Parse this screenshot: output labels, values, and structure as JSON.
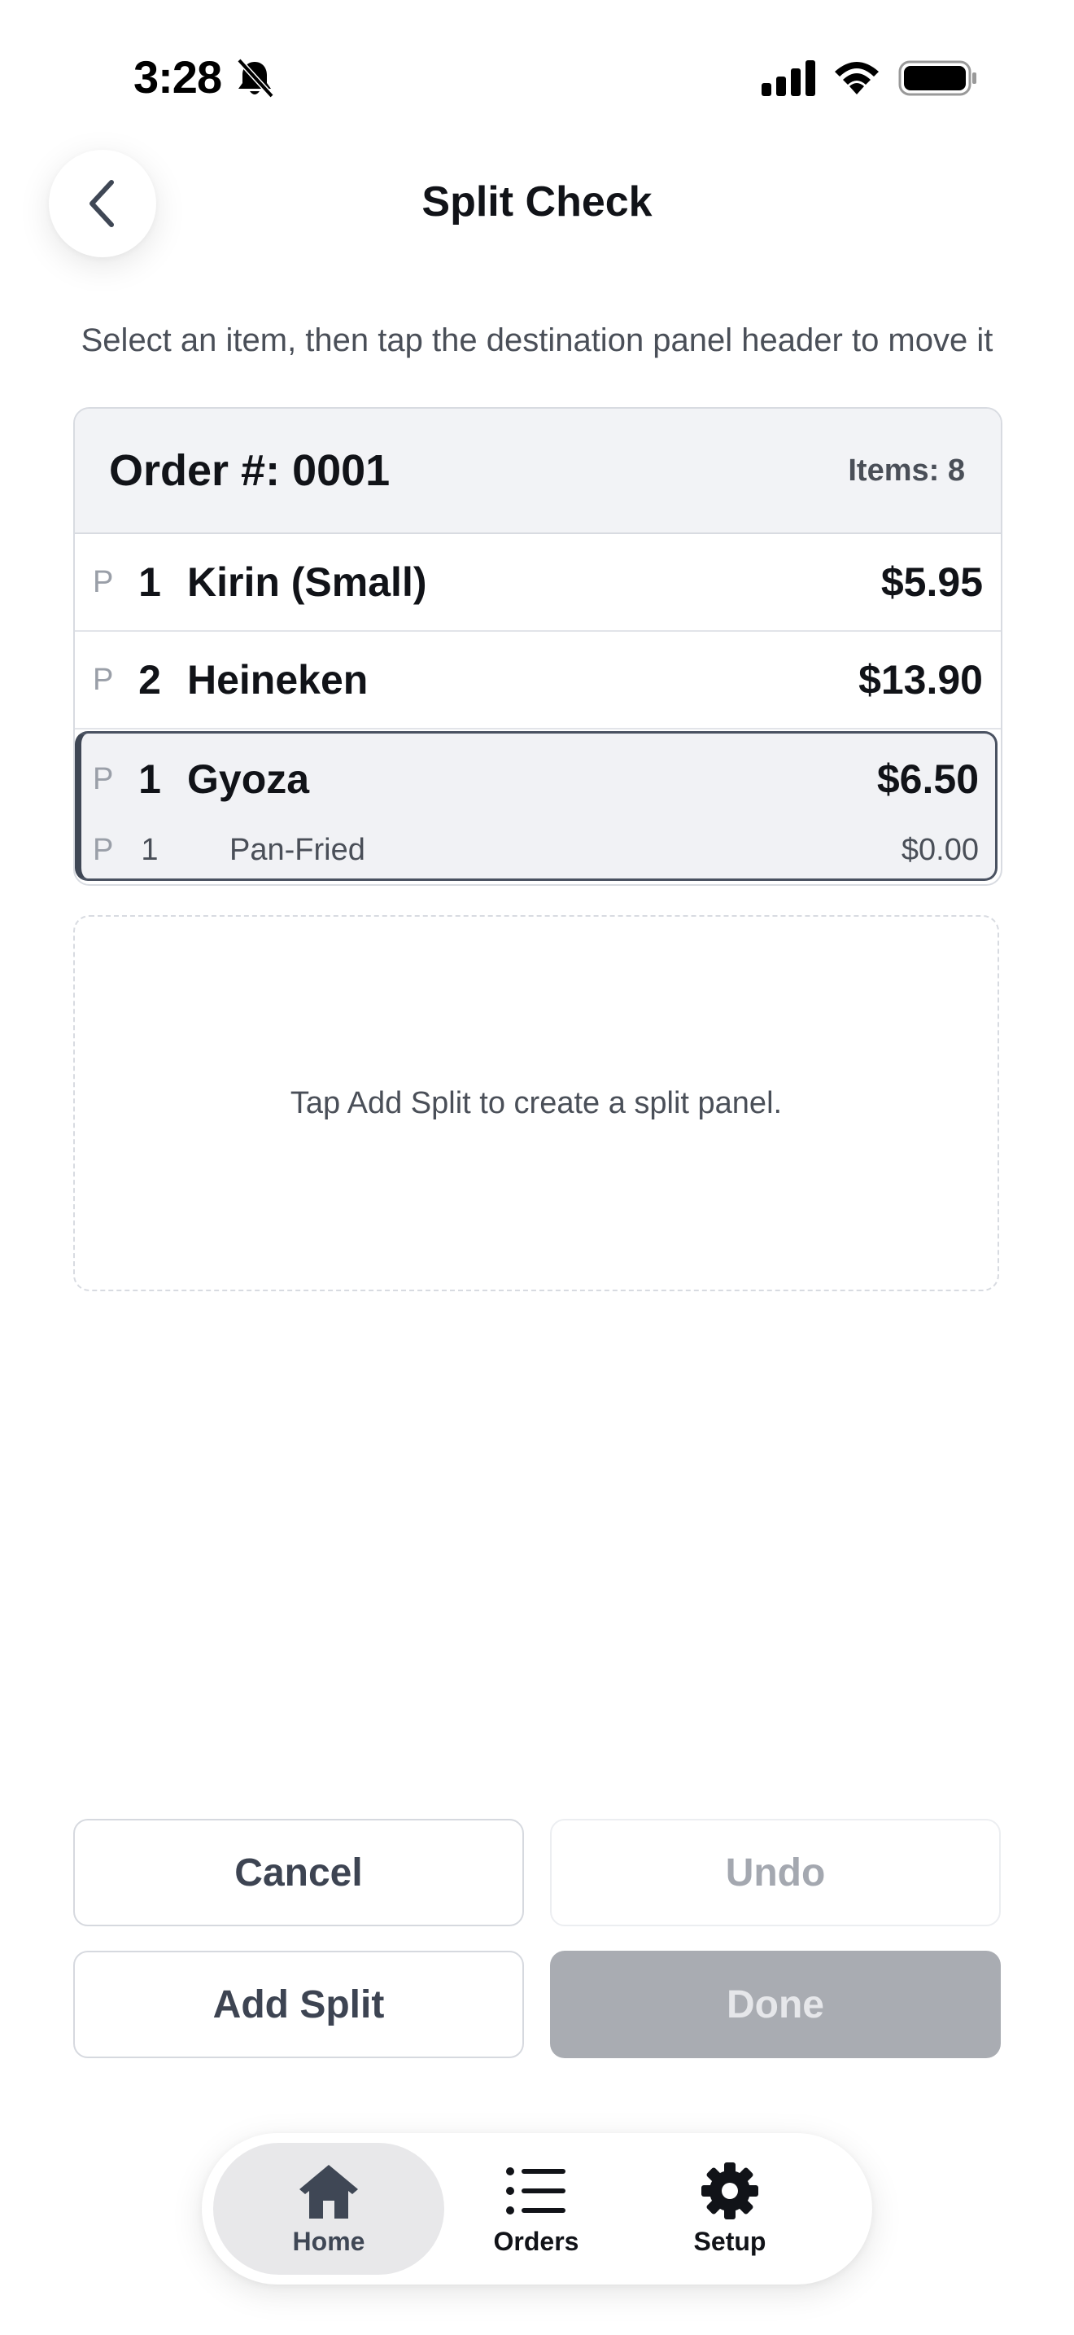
{
  "status_bar": {
    "time": "3:28",
    "silent_icon": "bell-slash-icon",
    "signal_icon": "cellular-signal-icon",
    "wifi_icon": "wifi-icon",
    "battery_icon": "battery-full-icon"
  },
  "header": {
    "back_icon": "chevron-left-icon",
    "title": "Split Check"
  },
  "instruction": "Select an item, then tap the destination panel header to move it",
  "order": {
    "title": "Order #: 0001",
    "items_count": "Items: 8",
    "items": [
      {
        "p": "P",
        "qty": "1",
        "name": "Kirin (Small)",
        "price": "$5.95"
      },
      {
        "p": "P",
        "qty": "2",
        "name": "Heineken",
        "price": "$13.90"
      },
      {
        "p": "P",
        "qty": "1",
        "name": "Gyoza",
        "price": "$6.50"
      }
    ],
    "selected_modifier": {
      "p": "P",
      "qty": "1",
      "name": "Pan-Fried",
      "price": "$0.00"
    }
  },
  "split_placeholder": "Tap Add Split to create a split panel.",
  "actions": {
    "cancel": "Cancel",
    "undo": "Undo",
    "add_split": "Add Split",
    "done": "Done"
  },
  "tab_bar": {
    "tabs": [
      {
        "label": "Home",
        "icon": "home-icon",
        "active": true
      },
      {
        "label": "Orders",
        "icon": "list-icon",
        "active": false
      },
      {
        "label": "Setup",
        "icon": "gear-icon",
        "active": false
      }
    ]
  },
  "colors": {
    "selected_border": "#3f4755",
    "panel_header_bg": "#f2f3f6",
    "done_disabled_bg": "#a9acb2"
  }
}
